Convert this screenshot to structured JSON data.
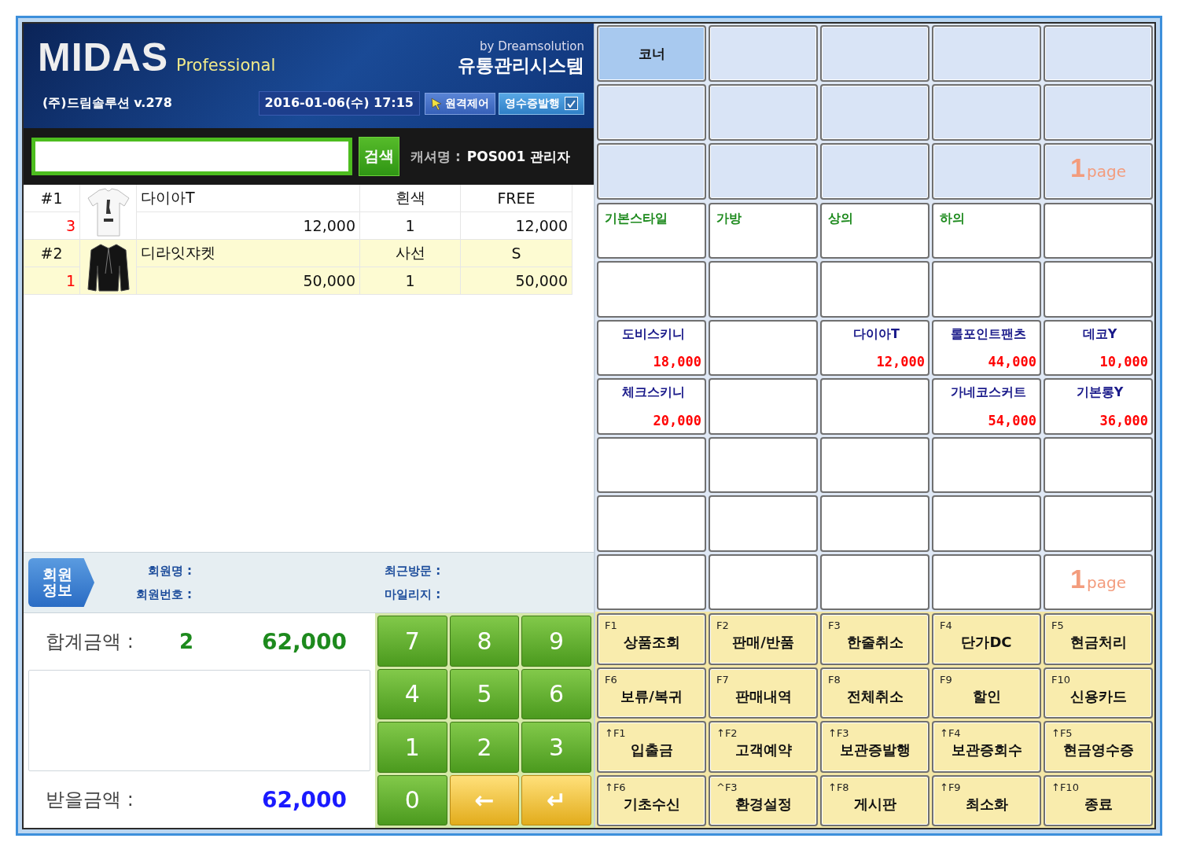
{
  "header": {
    "logo": "MIDAS",
    "edition": "Professional",
    "vendor": "by Dreamsolution",
    "system": "유통관리시스템",
    "company": "(주)드림솔루션 v.278",
    "datetime": "2016-01-06(수) 17:15",
    "remote_button": "원격제어",
    "receipt": {
      "label": "영수증발행",
      "checked": true
    }
  },
  "search": {
    "button": "검색",
    "cashier_label": "캐셔명 :",
    "cashier": "POS001 관리자"
  },
  "cart": {
    "rows": [
      {
        "number": "#1",
        "quantity": "3",
        "name": "다이아T",
        "option": "흰색",
        "size": "FREE",
        "unit_price": "12,000",
        "count": "1",
        "amount": "12,000",
        "kind": "tshirt",
        "selected": false
      },
      {
        "number": "#2",
        "quantity": "1",
        "name": "디라잇쟈켓",
        "option": "사선",
        "size": "S",
        "unit_price": "50,000",
        "count": "1",
        "amount": "50,000",
        "kind": "jacket",
        "selected": true
      }
    ]
  },
  "member": {
    "button": "회원정보",
    "fields": [
      "회원명 :",
      "최근방문 :",
      "회원번호 :",
      "마일리지 :"
    ]
  },
  "totals": {
    "total_label": "합계금액 :",
    "total_count": "2",
    "total_amount": "62,000",
    "due_label": "받을금액 :",
    "due_amount": "62,000"
  },
  "keypad": [
    {
      "label": "7",
      "kind": "digit"
    },
    {
      "label": "8",
      "kind": "digit"
    },
    {
      "label": "9",
      "kind": "digit"
    },
    {
      "label": "4",
      "kind": "digit"
    },
    {
      "label": "5",
      "kind": "digit"
    },
    {
      "label": "6",
      "kind": "digit"
    },
    {
      "label": "1",
      "kind": "digit"
    },
    {
      "label": "2",
      "kind": "digit"
    },
    {
      "label": "3",
      "kind": "digit"
    },
    {
      "label": "0",
      "kind": "digit"
    },
    {
      "label": "←",
      "kind": "action"
    },
    {
      "label": "↵",
      "kind": "action"
    }
  ],
  "corners": {
    "cells": [
      {
        "kind": "corner",
        "label": "코너",
        "selected": true
      },
      {
        "kind": "empty",
        "selected": false
      },
      {
        "kind": "empty",
        "selected": false
      },
      {
        "kind": "empty",
        "selected": false
      },
      {
        "kind": "empty",
        "selected": false
      },
      {
        "kind": "empty",
        "selected": false
      },
      {
        "kind": "empty",
        "selected": false
      },
      {
        "kind": "empty",
        "selected": false
      },
      {
        "kind": "empty",
        "selected": false
      },
      {
        "kind": "empty",
        "selected": false
      },
      {
        "kind": "empty",
        "selected": false
      },
      {
        "kind": "empty",
        "selected": false
      },
      {
        "kind": "empty",
        "selected": false
      },
      {
        "kind": "empty",
        "selected": false
      },
      {
        "kind": "page",
        "number": "1",
        "unit": "page"
      }
    ]
  },
  "products": {
    "cells": [
      {
        "kind": "category",
        "label": "기본스타일"
      },
      {
        "kind": "category",
        "label": "가방"
      },
      {
        "kind": "category",
        "label": "상의"
      },
      {
        "kind": "category",
        "label": "하의"
      },
      {
        "kind": "empty"
      },
      {
        "kind": "empty"
      },
      {
        "kind": "empty"
      },
      {
        "kind": "empty"
      },
      {
        "kind": "empty"
      },
      {
        "kind": "empty"
      },
      {
        "kind": "product",
        "label": "도비스키니",
        "price": "18,000"
      },
      {
        "kind": "empty"
      },
      {
        "kind": "product",
        "label": "다이아T",
        "price": "12,000"
      },
      {
        "kind": "product",
        "label": "롤포인트팬츠",
        "price": "44,000"
      },
      {
        "kind": "product",
        "label": "데코Y",
        "price": "10,000"
      },
      {
        "kind": "product",
        "label": "체크스키니",
        "price": "20,000"
      },
      {
        "kind": "empty"
      },
      {
        "kind": "empty"
      },
      {
        "kind": "product",
        "label": "가네코스커트",
        "price": "54,000"
      },
      {
        "kind": "product",
        "label": "기본롱Y",
        "price": "36,000"
      },
      {
        "kind": "empty"
      },
      {
        "kind": "empty"
      },
      {
        "kind": "empty"
      },
      {
        "kind": "empty"
      },
      {
        "kind": "empty"
      },
      {
        "kind": "empty"
      },
      {
        "kind": "empty"
      },
      {
        "kind": "empty"
      },
      {
        "kind": "empty"
      },
      {
        "kind": "empty"
      },
      {
        "kind": "empty"
      },
      {
        "kind": "empty"
      },
      {
        "kind": "empty"
      },
      {
        "kind": "empty"
      },
      {
        "kind": "page",
        "number": "1",
        "unit": "page"
      }
    ]
  },
  "function_keys": [
    {
      "key": "F1",
      "label": "상품조회"
    },
    {
      "key": "F2",
      "label": "판매/반품"
    },
    {
      "key": "F3",
      "label": "한줄취소"
    },
    {
      "key": "F4",
      "label": "단가DC"
    },
    {
      "key": "F5",
      "label": "현금처리"
    },
    {
      "key": "F6",
      "label": "보류/복귀"
    },
    {
      "key": "F7",
      "label": "판매내역"
    },
    {
      "key": "F8",
      "label": "전체취소"
    },
    {
      "key": "F9",
      "label": "할인"
    },
    {
      "key": "F10",
      "label": "신용카드"
    },
    {
      "key": "↑F1",
      "label": "입출금"
    },
    {
      "key": "↑F2",
      "label": "고객예약"
    },
    {
      "key": "↑F3",
      "label": "보관증발행"
    },
    {
      "key": "↑F4",
      "label": "보관증회수"
    },
    {
      "key": "↑F5",
      "label": "현금영수증"
    },
    {
      "key": "↑F6",
      "label": "기초수신"
    },
    {
      "key": "^F3",
      "label": "환경설정"
    },
    {
      "key": "↑F8",
      "label": "게시판"
    },
    {
      "key": "↑F9",
      "label": "최소화"
    },
    {
      "key": "↑F10",
      "label": "종료"
    }
  ]
}
